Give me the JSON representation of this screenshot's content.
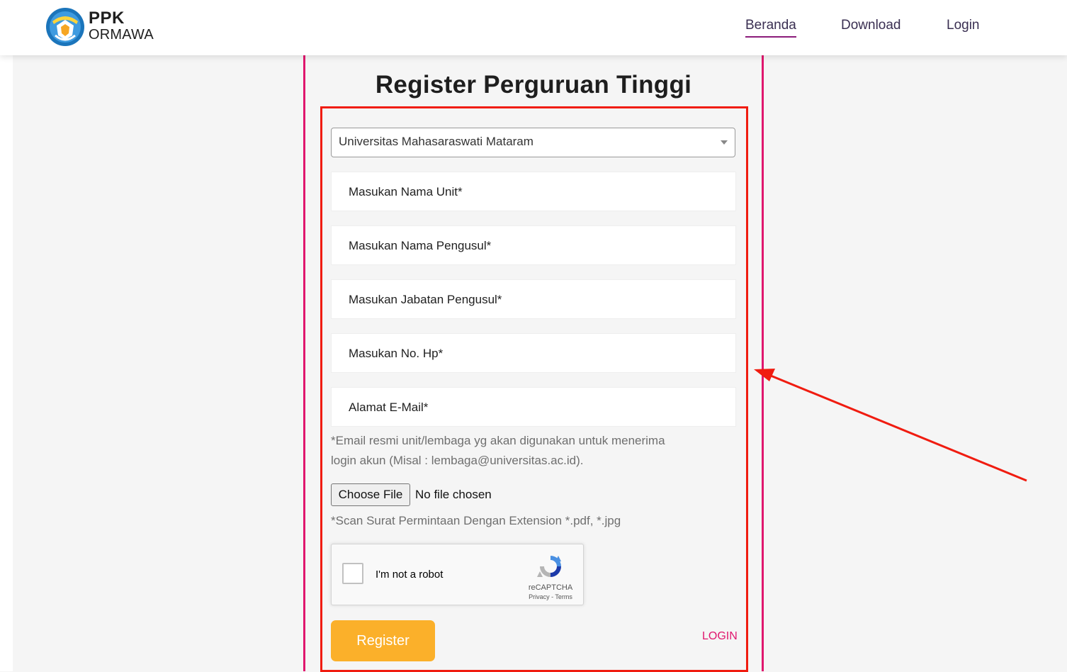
{
  "header": {
    "brand_top": "PPK",
    "brand_bottom": "ORMAWA",
    "nav": {
      "beranda": "Beranda",
      "download": "Download",
      "login": "Login"
    },
    "active_nav": "Beranda"
  },
  "form": {
    "title": "Register Perguruan Tinggi",
    "university_select": {
      "value": "Universitas Mahasaraswati Mataram",
      "icon": "chevron-down-icon"
    },
    "fields": [
      {
        "placeholder": "Masukan Nama Unit*"
      },
      {
        "placeholder": "Masukan Nama Pengusul*"
      },
      {
        "placeholder": "Masukan Jabatan Pengusul*"
      },
      {
        "placeholder": "Masukan No. Hp*"
      },
      {
        "placeholder": "Alamat E-Mail*"
      }
    ],
    "email_help_line1": "*Email resmi unit/lembaga yg akan digunakan untuk menerima",
    "email_help_line2": "login akun (Misal : lembaga@universitas.ac.id).",
    "file": {
      "button_label": "Choose File",
      "status": "No file chosen",
      "help": "*Scan Surat Permintaan Dengan Extension *.pdf, *.jpg"
    },
    "captcha": {
      "label": "I'm not a robot",
      "brand": "reCAPTCHA",
      "terms": "Privacy - Terms"
    },
    "register_label": "Register",
    "login_link": "LOGIN"
  },
  "colors": {
    "accent_pink": "#e0176e",
    "highlight_red": "#f01c10",
    "register_button": "#fbb02a",
    "nav_text": "#3a2f52"
  }
}
